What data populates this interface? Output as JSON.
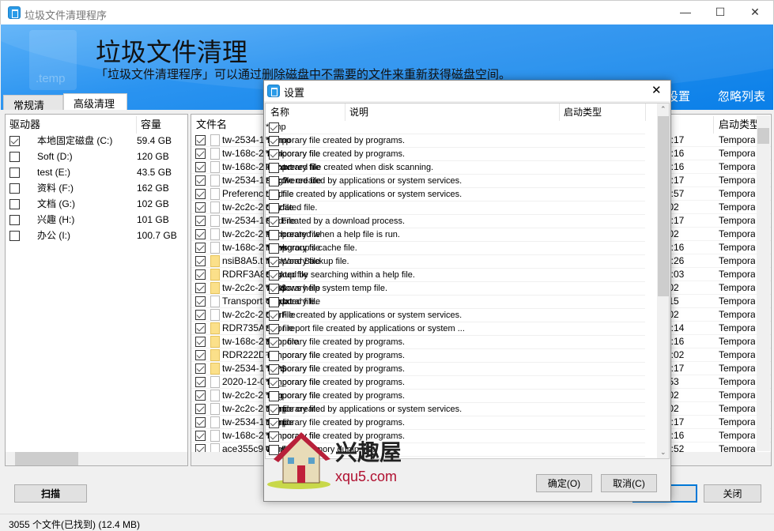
{
  "window": {
    "title": "垃圾文件清理程序",
    "minimize": "—",
    "maximize": "☐",
    "close": "✕"
  },
  "header": {
    "title": "垃圾文件清理",
    "subtitle": "「垃圾文件清理程序」可以通过删除磁盘中不需要的文件来重新获得磁盘空间。",
    "logo_text": ".temp",
    "links": [
      "设置",
      "忽略列表"
    ]
  },
  "tabs": [
    {
      "label": "常规清理",
      "active": false
    },
    {
      "label": "高级清理",
      "active": true
    }
  ],
  "drives": {
    "columns": [
      "驱动器",
      "容量"
    ],
    "items": [
      {
        "name": "本地固定磁盘 (C:)",
        "size": "59.4 GB",
        "checked": true
      },
      {
        "name": "Soft (D:)",
        "size": "120 GB",
        "checked": false
      },
      {
        "name": "test (E:)",
        "size": "43.5 GB",
        "checked": false
      },
      {
        "name": "资料 (F:)",
        "size": "162 GB",
        "checked": false
      },
      {
        "name": "文档 (G:)",
        "size": "102 GB",
        "checked": false
      },
      {
        "name": "兴趣 (H:)",
        "size": "101 GB",
        "checked": false
      },
      {
        "name": "办公 (I:)",
        "size": "100.7 GB",
        "checked": false
      }
    ]
  },
  "files": {
    "columns": [
      "文件名",
      "启动类型"
    ],
    "items": [
      {
        "name": "tw-2534-1c",
        "time": "7:17",
        "type": "Temporary",
        "folder": false
      },
      {
        "name": "tw-168c-2a",
        "time": "2:16",
        "type": "Temporary",
        "folder": false
      },
      {
        "name": "tw-168c-2a",
        "time": "2:16",
        "type": "Temporary",
        "folder": false
      },
      {
        "name": "tw-2534-1c",
        "time": "7:17",
        "type": "Temporary",
        "folder": false
      },
      {
        "name": "Preference",
        "time": "0:57",
        "type": "Temporary",
        "folder": false
      },
      {
        "name": "tw-2c2c-2b",
        "time": ":02",
        "type": "Temporary",
        "folder": false
      },
      {
        "name": "tw-2534-1c",
        "time": "7:17",
        "type": "Temporary",
        "folder": false
      },
      {
        "name": "tw-2c2c-2b",
        "time": ":02",
        "type": "Temporary",
        "folder": false
      },
      {
        "name": "tw-168c-2a",
        "time": "2:16",
        "type": "Temporary",
        "folder": false
      },
      {
        "name": "nsiB8A5.tm",
        "time": "9:26",
        "type": "Temporary",
        "folder": true
      },
      {
        "name": "RDRF3A8.t",
        "time": "2:03",
        "type": "Temporary",
        "folder": true
      },
      {
        "name": "tw-2c2c-2b",
        "time": ":02",
        "type": "Temporary",
        "folder": true
      },
      {
        "name": "TransportS",
        "time": ":15",
        "type": "Temporary",
        "folder": false
      },
      {
        "name": "tw-2c2c-2b",
        "time": ":02",
        "type": "Temporary",
        "folder": false
      },
      {
        "name": "RDR735A.t",
        "time": "0:14",
        "type": "Temporary",
        "folder": true
      },
      {
        "name": "tw-168c-2a",
        "time": "2:16",
        "type": "Temporary",
        "folder": true
      },
      {
        "name": "RDR222D.t",
        "time": "9:02",
        "type": "Temporary",
        "folder": true
      },
      {
        "name": "tw-2534-1c",
        "time": "7:17",
        "type": "Temporary",
        "folder": true
      },
      {
        "name": "2020-12-0",
        "time": ":53",
        "type": "Temporary",
        "folder": false
      },
      {
        "name": "tw-2c2c-2b",
        "time": ":02",
        "type": "Temporary",
        "folder": false
      },
      {
        "name": "tw-2c2c-2b",
        "time": ":02",
        "type": "Temporary",
        "folder": false
      },
      {
        "name": "tw-2534-1c",
        "time": "7:17",
        "type": "Temporary",
        "folder": false
      },
      {
        "name": "tw-168c-2a",
        "time": "2:16",
        "type": "Temporary",
        "folder": false
      },
      {
        "name": "ace355c9-",
        "time": "1:52",
        "type": "Temporary",
        "folder": false
      }
    ]
  },
  "buttons": {
    "scan": "扫描",
    "close": "关闭"
  },
  "status": "3055  个文件(已找到) (12.4 MB)",
  "dialog": {
    "title": "设置",
    "close": "✕",
    "columns": [
      "名称",
      "说明",
      "启动类型"
    ],
    "ok": "确定(O)",
    "cancel": "取消(C)",
    "rows": [
      {
        "name": "*.tmp",
        "desc": "Temporary file created by programs.",
        "type": "Temporary file",
        "checked": true
      },
      {
        "name": "*.temp",
        "desc": "Temporary file created by programs.",
        "type": "Temporary file",
        "checked": true
      },
      {
        "name": "*.chk",
        "desc": "Recovered file created when disk scanning.",
        "type": "Recovered file",
        "checked": true
      },
      {
        "name": "log*.txt",
        "desc": "Log file created by applications or system services.",
        "type": "Log file",
        "checked": false
      },
      {
        "name": "*.log?",
        "desc": "Log file created by applications or system services.",
        "type": "Log file",
        "checked": false
      },
      {
        "name": "*.old",
        "desc": "Outdated file.",
        "type": "Old File",
        "checked": false
      },
      {
        "name": "*.diz",
        "desc": "File created by a download process.",
        "type": "Temporary file",
        "checked": false
      },
      {
        "name": "*.gid",
        "desc": "File created when a help file is run.",
        "type": "Temporary file",
        "checked": true
      },
      {
        "name": "*.nch",
        "desc": "Newsgroup's cache file.",
        "type": "Temporary file",
        "checked": false
      },
      {
        "name": "*.wbk",
        "desc": "MS Word Backup file.",
        "type": "Backup file",
        "checked": false
      },
      {
        "name": "*.fts",
        "desc": "Created by searching within a help file.",
        "type": "Temporary file",
        "checked": true
      },
      {
        "name": "*.ftg",
        "desc": "Windows help system temp file.",
        "type": "Temporary file",
        "checked": true
      },
      {
        "name": "*.$$$",
        "desc": "Outdated file.",
        "type": "Old File",
        "checked": true
      },
      {
        "name": "*log.txt",
        "desc": "Log file created by applications or system services.",
        "type": "Log file",
        "checked": false
      },
      {
        "name": "*.err",
        "desc": "Error report file created by applications or system ...",
        "type": "Error file",
        "checked": true
      },
      {
        "name": "*.---",
        "desc": "Temporary file created by programs.",
        "type": "Temporary file",
        "checked": true
      },
      {
        "name": "*.~*",
        "desc": "Temporary file created by programs.",
        "type": "Temporary file",
        "checked": true
      },
      {
        "name": "~*.*",
        "desc": "Temporary file created by programs.",
        "type": "Temporary file",
        "checked": false
      },
      {
        "name": "*.??$",
        "desc": "Temporary file created by programs.",
        "type": "Temporary file",
        "checked": true
      },
      {
        "name": "*.___",
        "desc": "Temporary file created by programs.",
        "type": "Temporary file",
        "checked": true
      },
      {
        "name": "*.log",
        "desc": "Log file created by applications or system services.",
        "type": "Log file",
        "checked": false
      },
      {
        "name": "*.~mp",
        "desc": "Temporary file created by programs.",
        "type": "Temporary file",
        "checked": true
      },
      {
        "name": "*._mp",
        "desc": "Temporary file created by programs.",
        "type": "Temporary file",
        "checked": true
      },
      {
        "name": "*.d",
        "desc": "Windows memory dump file.",
        "type": "Temporary file",
        "checked": true
      },
      {
        "name": "",
        "desc": "",
        "type": "Old File",
        "checked": false
      }
    ]
  },
  "watermark": {
    "text": "兴趣屋",
    "url": "xqu5.com"
  }
}
